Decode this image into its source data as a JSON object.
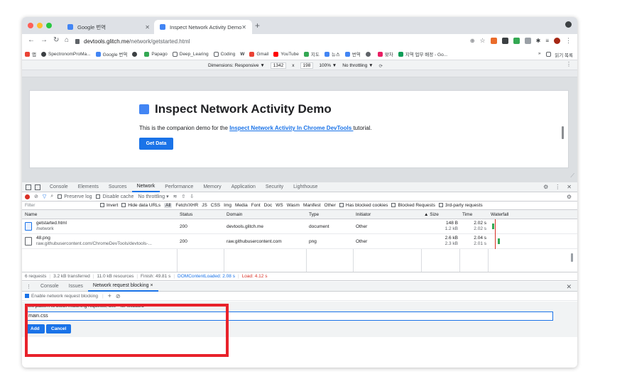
{
  "browser": {
    "tabs": [
      {
        "title": "Google 번역",
        "active": false
      },
      {
        "title": "Inspect Network Activity Demo",
        "active": true
      }
    ],
    "url_host": "devtools.glitch.me",
    "url_path": "/network/getstarted.html",
    "bookmarks": [
      "앱",
      "SpectronomProMa...",
      "Google 번역",
      "",
      "Papago",
      "Deep_Learing",
      "Coding",
      "W",
      "Gmail",
      "YouTube",
      "지도",
      "뉴스",
      "번역",
      "",
      "왓차",
      "지역 업무 배정 - Go...",
      "읽기 목록"
    ],
    "bookmark_more": "»",
    "colors": {
      "close": "#ff5f57",
      "minimize": "#febc2e",
      "maximize": "#28c840",
      "accent": "#1a73e8"
    }
  },
  "device_toolbar": {
    "dimensions_label": "Dimensions: Responsive ▼",
    "width": "1342",
    "times": "x",
    "height": "198",
    "zoom": "100% ▼",
    "throttle": "No throttling ▼"
  },
  "page": {
    "title": "Inspect Network Activity Demo",
    "desc_before": "This is the companion demo for the ",
    "desc_link": "Inspect Network Activity In Chrome DevTools ",
    "desc_after": "tutorial.",
    "button": "Get Data"
  },
  "devtools": {
    "tabs": [
      "Console",
      "Elements",
      "Sources",
      "Network",
      "Performance",
      "Memory",
      "Application",
      "Security",
      "Lighthouse"
    ],
    "active_tab": "Network",
    "toolbar": {
      "preserve_log": "Preserve log",
      "disable_cache": "Disable cache",
      "throttling": "No throttling"
    },
    "filter": {
      "label": "Filter",
      "invert": "Invert",
      "hide_data_urls": "Hide data URLs",
      "types": [
        "All",
        "Fetch/XHR",
        "JS",
        "CSS",
        "Img",
        "Media",
        "Font",
        "Doc",
        "WS",
        "Wasm",
        "Manifest",
        "Other"
      ],
      "has_blocked_cookies": "Has blocked cookies",
      "blocked_requests": "Blocked Requests",
      "third_party": "3rd-party requests"
    },
    "columns": [
      "Name",
      "Status",
      "Domain",
      "Type",
      "Initiator",
      "▲ Size",
      "Time",
      "Waterfall"
    ],
    "rows": [
      {
        "name": "getstarted.html",
        "path": "/network",
        "status": "200",
        "domain": "devtools.glitch.me",
        "type": "document",
        "initiator": "Other",
        "size1": "148 B",
        "size2": "1.2 kB",
        "time1": "2.02 s",
        "time2": "2.02 s"
      },
      {
        "name": "48.png",
        "path": "raw.githubusercontent.com/ChromeDevTools/devtools-...",
        "status": "200",
        "domain": "raw.githubusercontent.com",
        "type": "png",
        "initiator": "Other",
        "size1": "2.6 kB",
        "size2": "2.3 kB",
        "time1": "2.04 s",
        "time2": "2.01 s"
      }
    ],
    "summary": {
      "requests": "6 requests",
      "transferred": "3.2 kB transferred",
      "resources": "11.0 kB resources",
      "finish": "Finish: 49.81 s",
      "dcl": "DOMContentLoaded: 2.08 s",
      "load": "Load: 4.12 s"
    }
  },
  "drawer": {
    "tabs": [
      "Console",
      "Issues",
      "Network request blocking ×"
    ],
    "active_tab": "Network request blocking ×",
    "enable_label": "Enable network request blocking",
    "hint": "Text pattern to block matching requests; use * for wildcard",
    "input_value": "main.css",
    "add": "Add",
    "cancel": "Cancel"
  }
}
